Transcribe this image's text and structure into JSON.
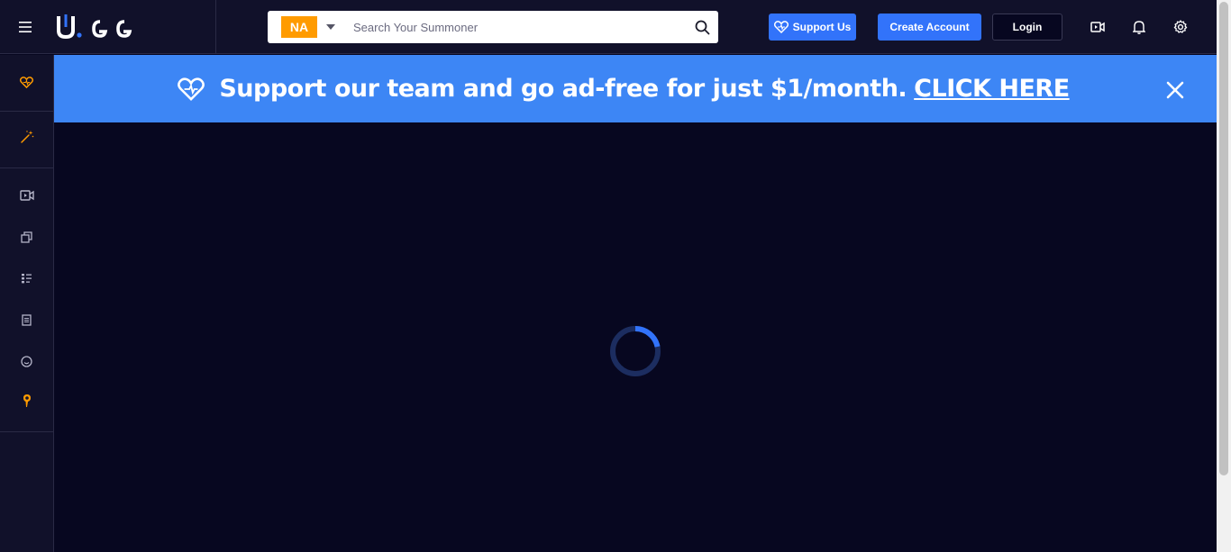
{
  "header": {
    "logo_text": "U.GG",
    "region": "NA",
    "search_placeholder": "Search Your Summoner",
    "support_label": "Support Us",
    "create_account_label": "Create Account",
    "login_label": "Login"
  },
  "banner": {
    "text": "Support our team and go ad-free for just $1/month.",
    "link_text": "CLICK HERE"
  },
  "icons": {
    "menu": "hamburger-icon",
    "caret": "caret-down-icon",
    "search": "search-icon",
    "video": "video-icon",
    "bell": "bell-icon",
    "settings": "gear-icon",
    "heart": "heart-icon",
    "close": "close-icon"
  },
  "sidebar": {
    "items": [
      {
        "icon": "heart-icon"
      },
      {
        "icon": "magic-wand-icon"
      },
      {
        "icon": "video-icon"
      },
      {
        "icon": "cards-icon"
      },
      {
        "icon": "tier-list-icon"
      },
      {
        "icon": "document-icon"
      },
      {
        "icon": "smiley-icon"
      },
      {
        "icon": "pin-icon"
      }
    ]
  },
  "colors": {
    "accent": "#3273fa",
    "banner": "#3d86f5",
    "region_badge": "#ff9b00",
    "background": "#070720",
    "panel": "#11112a",
    "sidebar_highlight": "#ff9b00"
  },
  "loading": {
    "state": "loading"
  }
}
